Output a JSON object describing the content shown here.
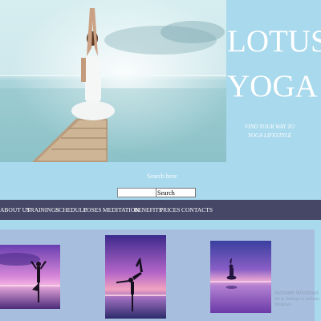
{
  "brand": {
    "title_line1": "LOTUS",
    "title_line2": "YOGA"
  },
  "tagline": {
    "line1": "FIND YOUR WAY TO",
    "line2": "YOGA LIFESTYLE"
  },
  "search": {
    "label": "Search here",
    "input_value": "",
    "button_label": "Search"
  },
  "nav": {
    "items": [
      {
        "label": "ABOUT US"
      },
      {
        "label": "TRAININGS"
      },
      {
        "label": "SCHEDULE"
      },
      {
        "label": "POSES"
      },
      {
        "label": "MEDITATION"
      },
      {
        "label": "BENEFITS"
      },
      {
        "label": "PRICES"
      },
      {
        "label": "CONTACTS"
      }
    ]
  },
  "watermark": {
    "line1": "Activate Windows",
    "line2": "Go to Settings to activate Windows."
  },
  "colors": {
    "page_bg": "#a8d9ec",
    "nav_bg": "#464766",
    "content_bg": "#a7bedf"
  },
  "icons": {
    "hero": "yoga-pier-photo",
    "thumb1": "tree-pose-photo",
    "thumb2": "dancer-pose-photo",
    "thumb3": "meditation-photo"
  }
}
